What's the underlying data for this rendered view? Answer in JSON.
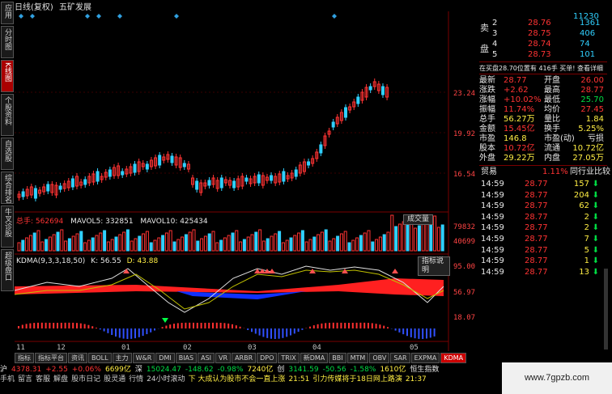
{
  "sidebar": {
    "tabs": [
      {
        "label": "应用",
        "active": false
      },
      {
        "label": "分时图",
        "active": false
      },
      {
        "label": "K线图",
        "active": true
      },
      {
        "label": "个股资料",
        "active": false
      },
      {
        "label": "自选股",
        "active": false
      },
      {
        "label": "综合排名",
        "active": false
      },
      {
        "label": "牛叉诊股",
        "active": false
      },
      {
        "label": "超级盘口",
        "active": false
      }
    ]
  },
  "topbar": {
    "period": "日线(复权)",
    "stock_name": "五矿发展"
  },
  "price_axis": [
    "23.24",
    "19.92",
    "16.54"
  ],
  "volume_header": {
    "label": "总手: 562694",
    "ma5": "MAVOL5: 332851",
    "ma10": "MAVOL10: 425434"
  },
  "volume_axis": [
    "79832",
    "40699"
  ],
  "volume_button": "成交量",
  "kdma_header": {
    "name": "KDMA(9,3,3,18,50)",
    "k": "K: 56.55",
    "d": "D: 43.88"
  },
  "kdma_button": "指标说明",
  "kdma_axis": [
    "95.00",
    "56.97",
    "18.07"
  ],
  "date_axis": [
    "11",
    "12",
    "01",
    "02",
    "03",
    "04",
    "05"
  ],
  "bottom_tabs": [
    {
      "label": "指标",
      "active": false
    },
    {
      "label": "指标平台",
      "active": false
    },
    {
      "label": "资讯",
      "active": false
    },
    {
      "label": "BOLL",
      "active": false
    },
    {
      "label": "主力",
      "active": false
    },
    {
      "label": "W&R",
      "active": false
    },
    {
      "label": "DMI",
      "active": false
    },
    {
      "label": "BIAS",
      "active": false
    },
    {
      "label": "ASI",
      "active": false
    },
    {
      "label": "VR",
      "active": false
    },
    {
      "label": "ARBR",
      "active": false
    },
    {
      "label": "DPO",
      "active": false
    },
    {
      "label": "TRIX",
      "active": false
    },
    {
      "label": "新DMA",
      "active": false
    },
    {
      "label": "BBI",
      "active": false
    },
    {
      "label": "MTM",
      "active": false
    },
    {
      "label": "OBV",
      "active": false
    },
    {
      "label": "SAR",
      "active": false
    },
    {
      "label": "EXPMA",
      "active": false
    },
    {
      "label": "KDMA",
      "active": true
    }
  ],
  "index_bar": {
    "sh_label": "沪",
    "sh_val": "4378.31",
    "sh_chg": "+2.55",
    "sh_pct": "+0.06%",
    "sh_amount": "6699亿",
    "sz_label": "深",
    "sz_val": "15024.47",
    "sz_chg": "-148.62",
    "sz_pct": "-0.98%",
    "sz_amount": "7240亿",
    "cy_label": "创",
    "cy_val": "3141.59",
    "cy_chg": "-50.56",
    "cy_pct": "-1.58%",
    "cy_amount": "1610亿",
    "hs_label": "恒生指数"
  },
  "status_bar": {
    "items": [
      "手机",
      "留言",
      "客服",
      "解盘",
      "股市日记",
      "股灵通",
      "行情",
      "24小时滚动"
    ],
    "news1": "下 大成认为股市不会一直上涨",
    "time1": "21:51",
    "news2": "引力传媒将于18日网上路演",
    "time2": "21:37"
  },
  "watermark": "www.7gpzb.com",
  "order_book": {
    "sell_label": "卖",
    "buy_label": "买",
    "pan_label": "盘",
    "levels": [
      {
        "n": "2",
        "price": "28.76",
        "vol": "1361"
      },
      {
        "n": "3",
        "price": "28.75",
        "vol": "406"
      },
      {
        "n": "4",
        "price": "28.74",
        "vol": "74"
      },
      {
        "n": "5",
        "price": "28.73",
        "vol": "101"
      }
    ],
    "top_vol": "11230"
  },
  "summary": {
    "line": "在买盘28.70位置有 416手 买单! 查看详细",
    "rows": [
      {
        "l1": "最新",
        "v1": "28.77",
        "l2": "开盘",
        "v2": "26.00"
      },
      {
        "l1": "涨跌",
        "v1": "+2.62",
        "l2": "最高",
        "v2": "28.77"
      },
      {
        "l1": "涨幅",
        "v1": "+10.02%",
        "l2": "最低",
        "v2": "25.70"
      },
      {
        "l1": "振幅",
        "v1": "11.74%",
        "l2": "均价",
        "v2": "27.45"
      },
      {
        "l1": "总手",
        "v1": "56.27万",
        "l2": "量比",
        "v2": "1.84"
      },
      {
        "l1": "金额",
        "v1": "15.45亿",
        "l2": "换手",
        "v2": "5.25%"
      },
      {
        "l1": "市盈",
        "v1": "146.8",
        "l2": "市盈(动)",
        "v2": "亏损"
      },
      {
        "l1": "股本",
        "v1": "10.72亿",
        "l2": "流通",
        "v2": "10.72亿"
      },
      {
        "l1": "外盘",
        "v1": "29.22万",
        "l2": "内盘",
        "v2": "27.05万"
      }
    ]
  },
  "trade_header": {
    "left": "贸易",
    "pct": "1.11%",
    "right": "同行业比较"
  },
  "trades": [
    {
      "time": "14:59",
      "price": "28.77",
      "vol": "157"
    },
    {
      "time": "14:59",
      "price": "28.77",
      "vol": "204"
    },
    {
      "time": "14:59",
      "price": "28.77",
      "vol": "62"
    },
    {
      "time": "14:59",
      "price": "28.77",
      "vol": "2"
    },
    {
      "time": "14:59",
      "price": "28.77",
      "vol": "2"
    },
    {
      "time": "14:59",
      "price": "28.77",
      "vol": "7"
    },
    {
      "time": "14:59",
      "price": "28.77",
      "vol": "5"
    },
    {
      "time": "14:59",
      "price": "28.77",
      "vol": "1"
    },
    {
      "time": "14:59",
      "price": "28.77",
      "vol": "13"
    }
  ],
  "colors": {
    "up": "#ff3333",
    "down": "#30d0ff",
    "kdma_red": "#ff2020",
    "kdma_blue": "#1030ff",
    "vol_up": "#ff3333",
    "vol_down": "#30d0ff"
  }
}
